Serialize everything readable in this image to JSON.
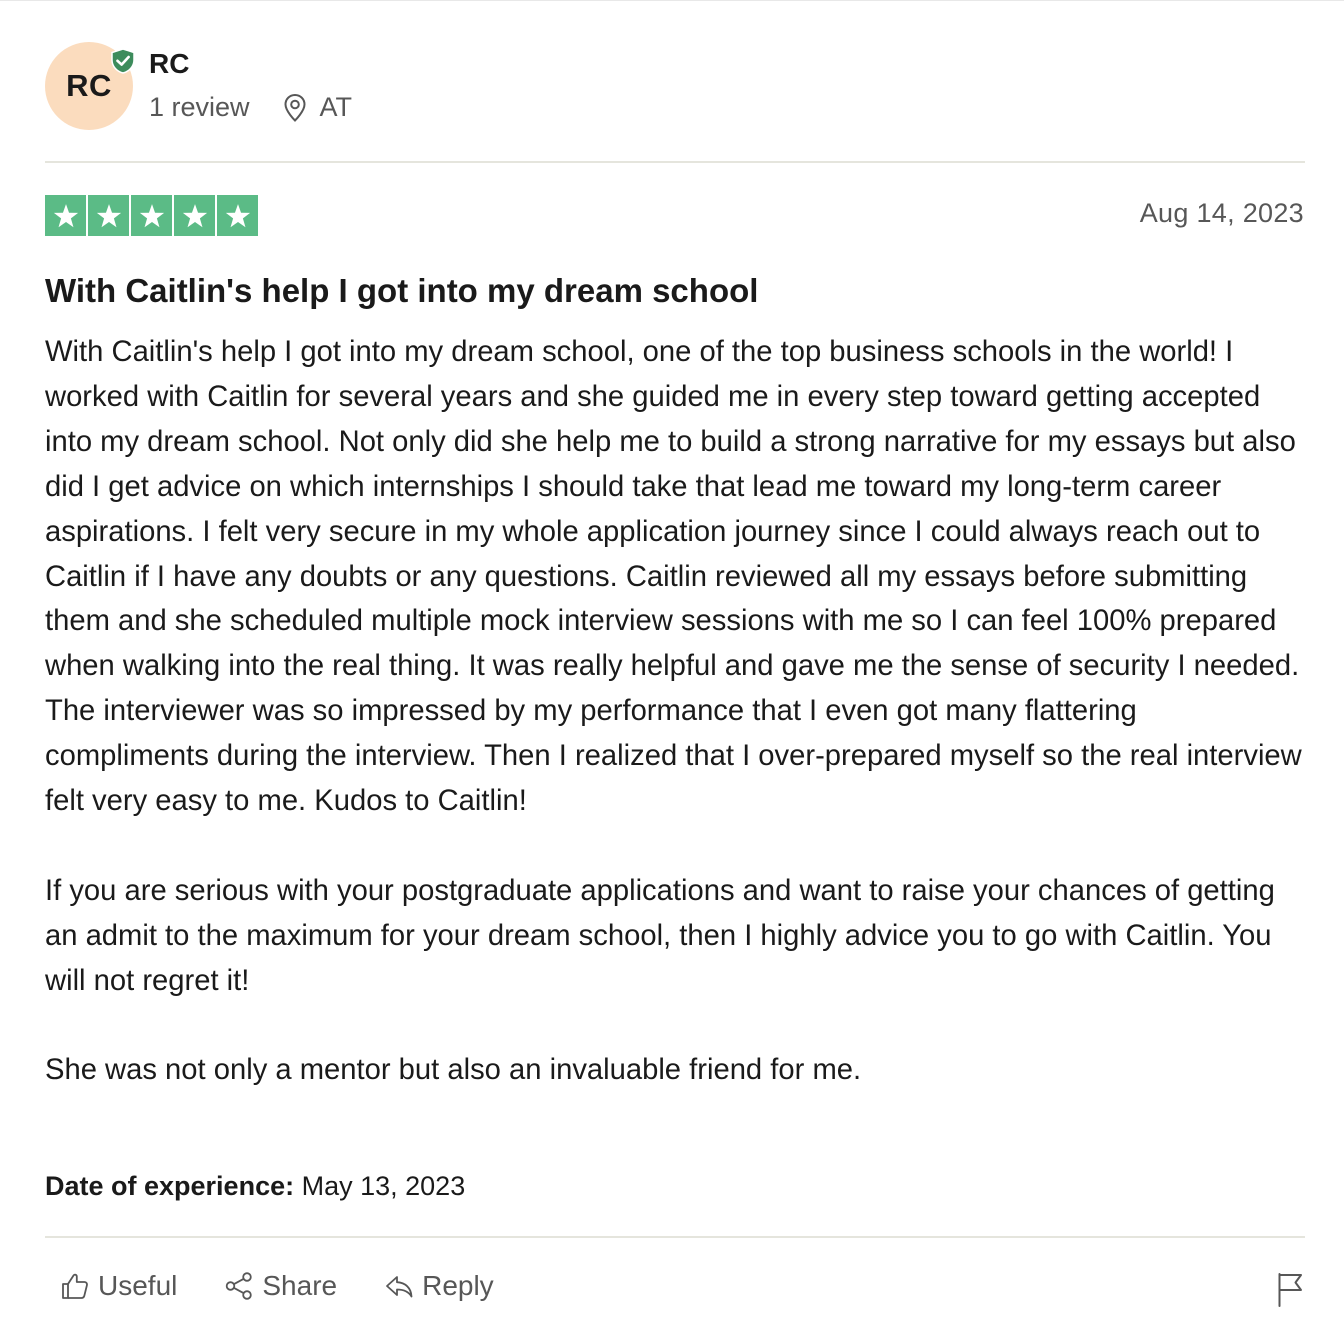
{
  "reviewer": {
    "initials": "RC",
    "name": "RC",
    "review_count": "1 review",
    "location": "AT",
    "verified": true
  },
  "review": {
    "rating": 5,
    "max_rating": 5,
    "date": "Aug 14, 2023",
    "title": "With Caitlin's help I got into my dream school",
    "paragraphs": [
      "With Caitlin's help I got into my dream school, one of the top business schools in the world! I worked with Caitlin for several years and she guided me in every step toward getting accepted into my dream school. Not only did she help me to build a strong narrative for my essays but also did I get advice on which internships I should take that lead me toward my long-term career aspirations. I felt very secure in my whole application journey since I could always reach out to Caitlin if I have any doubts or any questions. Caitlin reviewed all my essays before submitting them and she scheduled multiple mock interview sessions with me so I can feel 100% prepared when walking into the real thing. It was really helpful and gave me the sense of security I needed. The interviewer was so impressed by my performance that I even got many flattering compliments during the interview. Then I realized that I over-prepared myself so the real interview felt very easy to me. Kudos to Caitlin!",
      "If you are serious with your postgraduate applications and want to raise your chances of getting an admit to the maximum for your dream school, then I highly advice you to go with Caitlin. You will not regret it!",
      "She was not only a mentor but also an invaluable friend for me."
    ],
    "experience_label": "Date of experience:",
    "experience_date": "May 13, 2023"
  },
  "actions": {
    "useful": "Useful",
    "share": "Share",
    "reply": "Reply"
  },
  "icons": {
    "verified": "shield-check-icon",
    "location": "map-pin-icon",
    "star": "star-icon",
    "useful": "thumbs-up-icon",
    "share": "share-icon",
    "reply": "reply-arrow-icon",
    "flag": "flag-icon"
  },
  "colors": {
    "star_green": "#5bbb86",
    "verified_green": "#3d8c5c",
    "avatar_bg": "#fbdcbe",
    "muted_text": "#575757"
  }
}
